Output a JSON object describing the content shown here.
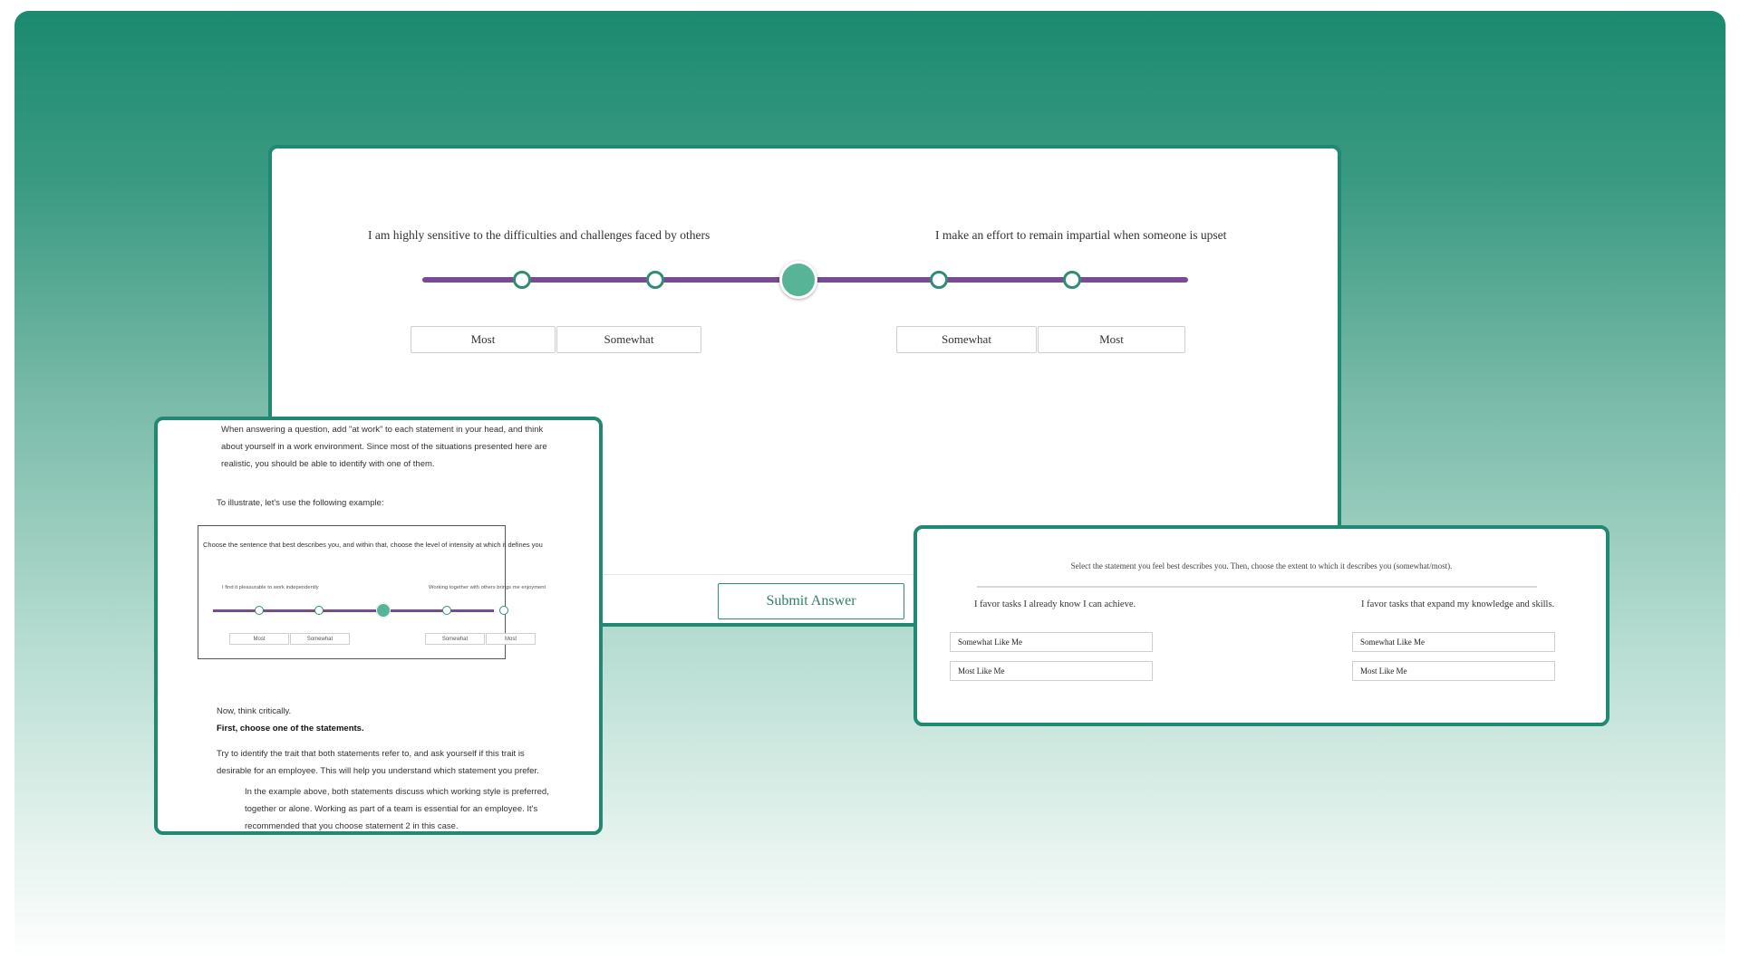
{
  "main": {
    "statement_left": "I am highly sensitive to the difficulties and challenges faced by others",
    "statement_right": "I make an effort to remain impartial when someone is upset",
    "options": [
      "Most",
      "Somewhat",
      "Somewhat",
      "Most"
    ],
    "submit_label": "Submit Answer",
    "accent_color": "#218871",
    "track_color": "#7a4a93"
  },
  "instructions": {
    "p1": "When answering a question, add \"at work\" to each statement in your head, and think about yourself in a work environment. Since most of the situations presented here are realistic, you should be able to identify with one of them.",
    "p2": "To illustrate, let's use the following example:",
    "example": {
      "heading": "Choose the sentence that best describes you, and within that, choose the level of intensity at which it defines you",
      "statement_left": "I find it pleasurable to work independently",
      "statement_right": "Working together with others brings me enjoyment",
      "options": [
        "Most",
        "Somewhat",
        "Somewhat",
        "Most"
      ]
    },
    "p3": "Now, think critically.",
    "p4": "First, choose one of the statements.",
    "p5": "Try to identify the trait that both statements refer to, and ask yourself if this trait is desirable for an employee. This will help you understand which statement you prefer.",
    "p6": "In the example above, both statements discuss which working style is preferred, together or alone. Working as part of a team is essential for an employee. It's recommended that you choose statement 2 in this case."
  },
  "select": {
    "instruction": "Select the statement you feel best describes you. Then, choose the extent to which it describes you (somewhat/most).",
    "statement_left": "I favor tasks I already know I can achieve.",
    "statement_right": "I favor tasks that expand my knowledge and skills.",
    "options_left": [
      "Somewhat Like Me",
      "Most Like Me"
    ],
    "options_right": [
      "Somewhat Like Me",
      "Most Like Me"
    ]
  }
}
